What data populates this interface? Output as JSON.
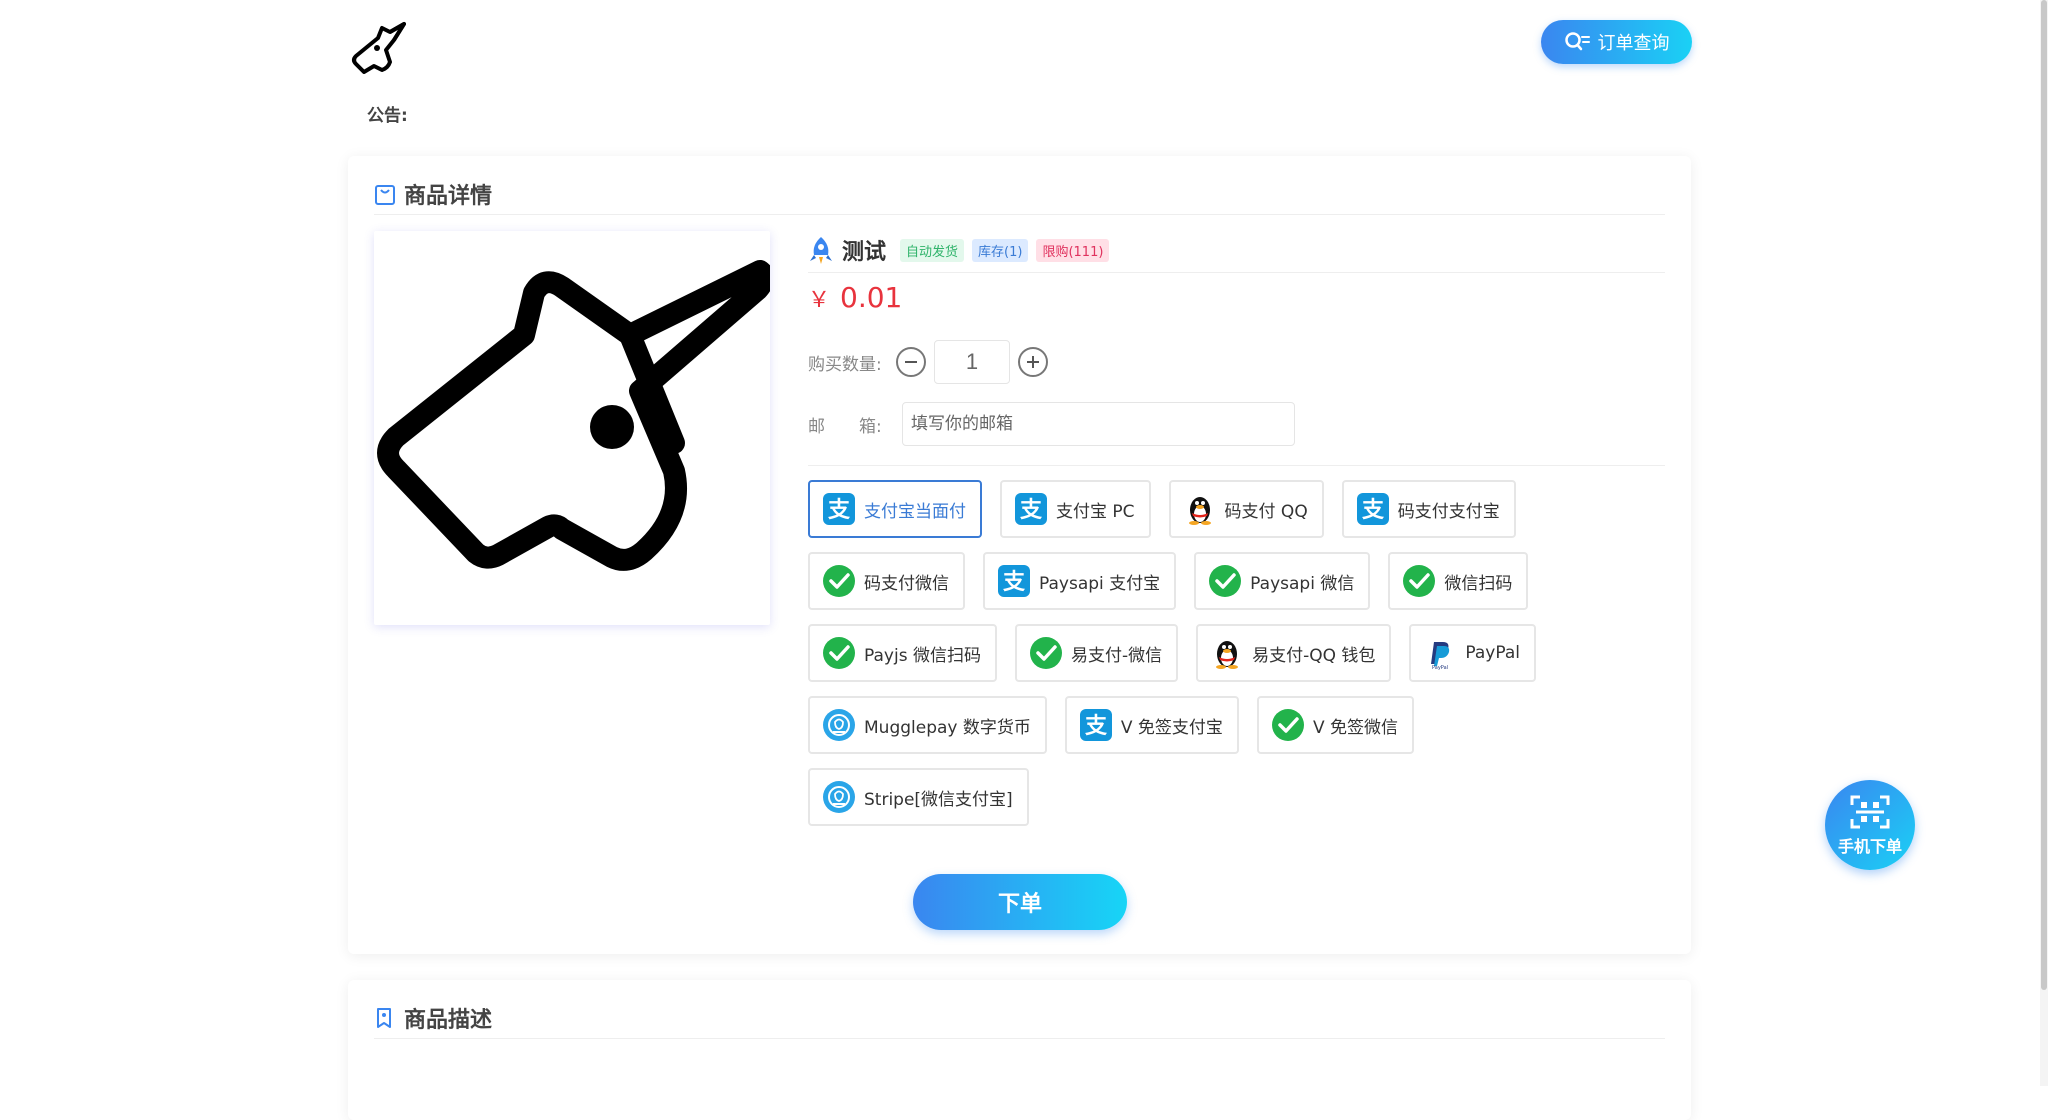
{
  "header": {
    "order_query_label": "订单查询",
    "notice_label": "公告:"
  },
  "detail_card": {
    "title": "商品详情",
    "product": {
      "name": "测试",
      "badges": [
        "自动发货",
        "库存(1)",
        "限购(111)"
      ],
      "currency_symbol": "￥",
      "price": "0.01"
    },
    "quantity": {
      "label": "购买数量:",
      "value": "1"
    },
    "email": {
      "label": "邮　　箱:",
      "placeholder": "填写你的邮箱"
    },
    "payments": [
      {
        "label": "支付宝当面付",
        "icon": "alipay-icon",
        "active": true
      },
      {
        "label": "支付宝 PC",
        "icon": "alipay-icon",
        "active": false
      },
      {
        "label": "码支付 QQ",
        "icon": "qq-penguin-icon",
        "active": false
      },
      {
        "label": "码支付支付宝",
        "icon": "alipay-icon",
        "active": false
      },
      {
        "label": "码支付微信",
        "icon": "wechat-icon",
        "active": false
      },
      {
        "label": "Paysapi 支付宝",
        "icon": "alipay-icon",
        "active": false
      },
      {
        "label": "Paysapi 微信",
        "icon": "wechat-icon",
        "active": false
      },
      {
        "label": "微信扫码",
        "icon": "wechat-icon",
        "active": false
      },
      {
        "label": "Payjs 微信扫码",
        "icon": "wechat-icon",
        "active": false
      },
      {
        "label": "易支付-微信",
        "icon": "wechat-icon",
        "active": false
      },
      {
        "label": "易支付-QQ 钱包",
        "icon": "qq-penguin-icon",
        "active": false
      },
      {
        "label": "PayPal",
        "icon": "paypal-icon",
        "active": false
      },
      {
        "label": "Mugglepay 数字货币",
        "icon": "mugglepay-icon",
        "active": false
      },
      {
        "label": "V 免签支付宝",
        "icon": "alipay-icon",
        "active": false
      },
      {
        "label": "V 免签微信",
        "icon": "wechat-icon",
        "active": false
      },
      {
        "label": "Stripe[微信支付宝]",
        "icon": "mugglepay-icon",
        "active": false
      }
    ],
    "submit_label": "下单"
  },
  "description_card": {
    "title": "商品描述"
  },
  "floating": {
    "mobile_order_label": "手机下单"
  },
  "colors": {
    "accent": "#3a86f0",
    "price": "#e8333d",
    "alipay": "#1296db",
    "wechat": "#22b34b"
  }
}
